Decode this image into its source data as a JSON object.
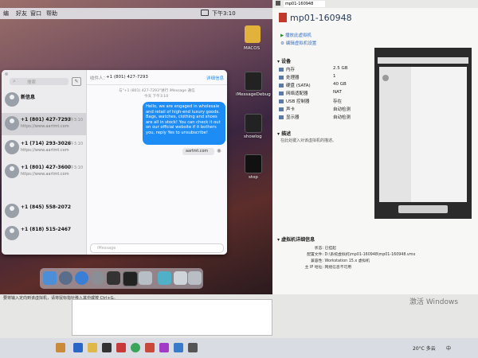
{
  "mac_menubar": {
    "items": [
      "编",
      "好友",
      "窗口",
      "帮助"
    ],
    "clock": "下午3:10"
  },
  "messages": {
    "search_placeholder": "搜索",
    "to_label": "收件人：",
    "to_value": "+1 (801) 427-7293",
    "details_label": "详细信息",
    "header_note_1": "与\"+1 (801) 427-7293\"进行 iMessage 通信",
    "header_note_2": "今天 下午3:10",
    "bubble_text": "Hello, we are engaged in wholesale and retail of high-end luxury goods. Bags, watches, clothing and shoes are all in stock! You can check it out on our official website if it bothers you, reply Yes to unsubscribe!",
    "link_preview": "aartmt.com",
    "input_placeholder": "iMessage",
    "conversations": [
      {
        "name": "新信息",
        "sub": "",
        "time": ""
      },
      {
        "name": "+1 (801) 427-7293",
        "sub": "https://www.aartmt.com",
        "time": "下午3:10"
      },
      {
        "name": "+1 (714) 293-3026",
        "sub": "https://www.aartmt.com",
        "time": "下午3:10"
      },
      {
        "name": "+1 (801) 427-3600",
        "sub": "https://www.aartmt.com",
        "time": "下午3:10"
      },
      {
        "name": "+1 (845) 558-2072",
        "sub": "",
        "time": ""
      },
      {
        "name": "+1 (818) 515-2467",
        "sub": "",
        "time": ""
      }
    ]
  },
  "desktop_icons": [
    {
      "label": "MACOS",
      "color": "#e2b23a"
    },
    {
      "label": "iMessageDebug",
      "color": "#222222"
    },
    {
      "label": "showlog",
      "color": "#222222"
    },
    {
      "label": "stop",
      "color": "#111111"
    }
  ],
  "vmware": {
    "vm_title": "mp01-160948",
    "tab_title": "mp01-160948",
    "action_start": "播放此虚拟机",
    "action_edit": "编辑虚拟机设置",
    "devices_header": "设备",
    "devices": [
      {
        "name": "内存",
        "value": "2.5 GB"
      },
      {
        "name": "处理器",
        "value": "1"
      },
      {
        "name": "硬盘 (SATA)",
        "value": "40 GB"
      },
      {
        "name": "网络适配器",
        "value": "NAT"
      },
      {
        "name": "USB 控制器",
        "value": "存在"
      },
      {
        "name": "声卡",
        "value": "自动检测"
      },
      {
        "name": "显示器",
        "value": "自动检测"
      }
    ],
    "description_header": "描述",
    "description_text": "在此处键入对该虚拟机的描述。",
    "details_header": "虚拟机详细信息",
    "details": [
      {
        "label": "状态:",
        "value": "已挂起"
      },
      {
        "label": "配置文件:",
        "value": "D:\\系统虚拟机\\mp01-160948\\mp01-160948.vmx"
      },
      {
        "label": "兼容性:",
        "value": "Workstation 15.x 虚拟机"
      },
      {
        "label": "主 IP 地址:",
        "value": "网络信息不可用"
      }
    ],
    "accent": "#3a6fc4"
  },
  "bottom_text": "要将输入定向到该虚拟机，请将鼠标指针移入其中或按 Ctrl+G。",
  "activate_windows": "激活 Windows",
  "tray": {
    "weather": "20°C 多云",
    "lang": "中"
  }
}
